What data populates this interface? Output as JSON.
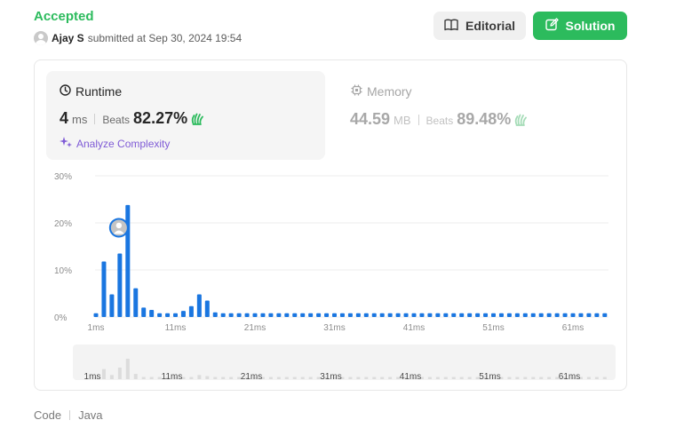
{
  "submission": {
    "status": "Accepted",
    "user": "Ajay S",
    "submitted_text": "submitted at Sep 30, 2024 19:54"
  },
  "header_buttons": {
    "editorial": "Editorial",
    "solution": "Solution"
  },
  "runtime": {
    "title": "Runtime",
    "value": "4",
    "unit": "ms",
    "beats_label": "Beats",
    "beats_value": "82.27%",
    "analyze_label": "Analyze Complexity"
  },
  "memory": {
    "title": "Memory",
    "value": "44.59",
    "unit": "MB",
    "beats_label": "Beats",
    "beats_value": "89.48%"
  },
  "chart_data": {
    "type": "bar",
    "y_ticks": [
      "30%",
      "20%",
      "10%",
      "0%"
    ],
    "ylim": [
      0,
      30
    ],
    "x_tick_labels": [
      "1ms",
      "11ms",
      "21ms",
      "31ms",
      "41ms",
      "51ms",
      "61ms"
    ],
    "x_tick_indices": [
      0,
      10,
      20,
      30,
      40,
      50,
      60
    ],
    "values": [
      0.8,
      11.8,
      4.8,
      13.5,
      23.8,
      6.1,
      2.0,
      1.5,
      0.8,
      0.8,
      0.8,
      1.3,
      2.3,
      4.8,
      3.5,
      1.0,
      0.8,
      0.8,
      0.8,
      0.8,
      0.8,
      0.8,
      0.8,
      0.8,
      0.8,
      0.8,
      0.8,
      0.8,
      0.8,
      0.8,
      0.8,
      0.8,
      0.8,
      0.8,
      0.8,
      0.8,
      0.8,
      0.8,
      0.8,
      0.8,
      0.8,
      0.8,
      0.8,
      0.8,
      0.8,
      0.8,
      0.8,
      0.8,
      0.8,
      0.8,
      0.8,
      0.8,
      0.8,
      0.8,
      0.8,
      0.8,
      0.8,
      0.8,
      0.8,
      0.8,
      0.8,
      0.8,
      0.8,
      0.8,
      0.8
    ],
    "user_bar_index": 3,
    "bar_color": "#1a76e0",
    "grid": true
  },
  "colors": {
    "accepted": "#2cbb5d",
    "accent_purple": "#7f5bd6",
    "hand_green": "#2cbb5d"
  },
  "footer": {
    "code_label": "Code",
    "language": "Java"
  }
}
